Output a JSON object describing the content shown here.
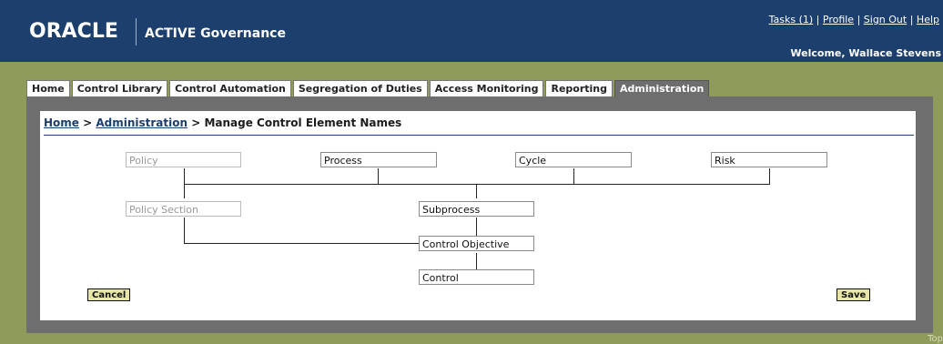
{
  "header": {
    "logo": "ORACLE",
    "product": "ACTIVE Governance",
    "links": [
      "Tasks (1)",
      "Profile",
      "Sign Out",
      "Help"
    ],
    "welcome": "Welcome, Wallace Stevens"
  },
  "tabs": [
    {
      "label": "Home"
    },
    {
      "label": "Control Library"
    },
    {
      "label": "Control Automation"
    },
    {
      "label": "Segregation of Duties"
    },
    {
      "label": "Access Monitoring"
    },
    {
      "label": "Reporting"
    },
    {
      "label": "Administration",
      "active": true
    }
  ],
  "breadcrumb": {
    "home": "Home",
    "sep1": " > ",
    "admin": "Administration",
    "sep2": " > ",
    "current": "Manage Control Element Names"
  },
  "fields": {
    "policy": "Policy",
    "process": "Process",
    "cycle": "Cycle",
    "risk": "Risk",
    "policy_section": "Policy Section",
    "subprocess": "Subprocess",
    "control_objective": "Control Objective",
    "control": "Control"
  },
  "buttons": {
    "cancel": "Cancel",
    "save": "Save"
  },
  "footer": {
    "top": "Top"
  }
}
